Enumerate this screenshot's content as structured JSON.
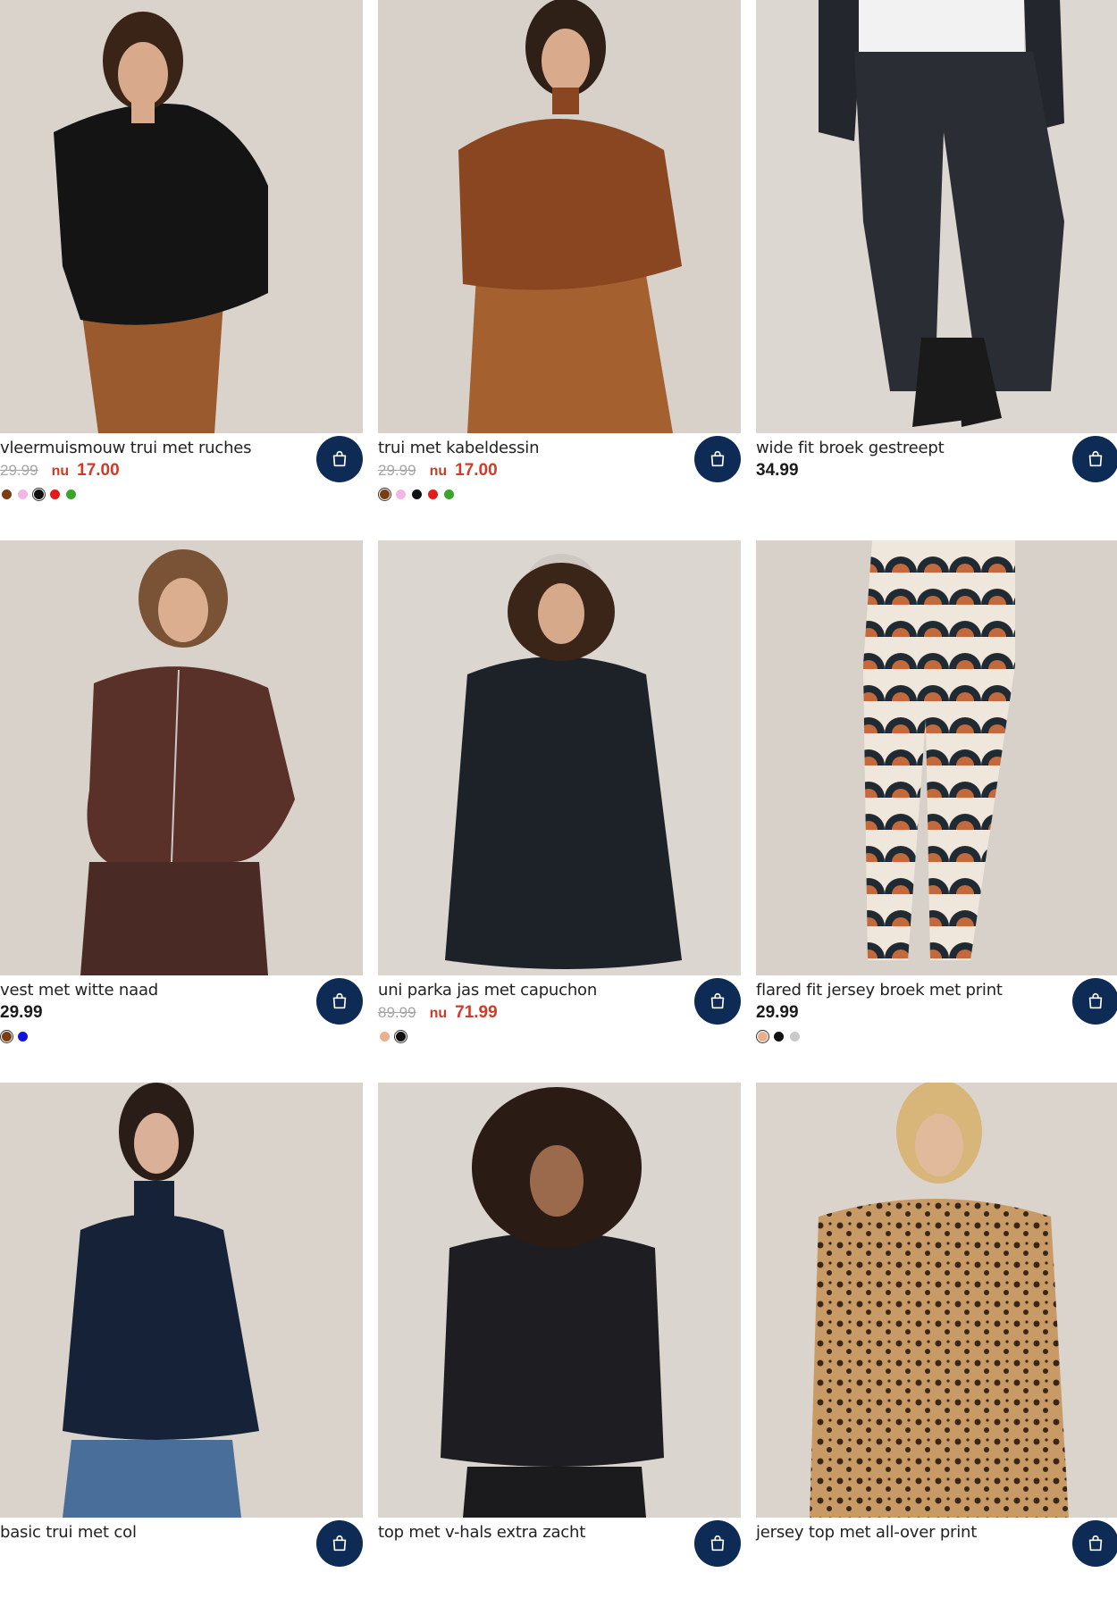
{
  "products": [
    {
      "title": "vleermuismouw trui met ruches",
      "old_price": "29.99",
      "now_label": "nu",
      "price": "17.00",
      "on_sale": true,
      "swatches": [
        "#7a3e12",
        "#f2b6e6",
        "#111111",
        "#e21b1b",
        "#3aa52a"
      ],
      "selected_swatch": 2,
      "image_alt": "model in black ruffle-sleeve sweater"
    },
    {
      "title": "trui met kabeldessin",
      "old_price": "29.99",
      "now_label": "nu",
      "price": "17.00",
      "on_sale": true,
      "swatches": [
        "#7a3e12",
        "#f2b6e6",
        "#111111",
        "#e21b1b",
        "#3aa52a"
      ],
      "selected_swatch": 0,
      "image_alt": "model in brown cable-knit sweater"
    },
    {
      "title": "wide fit broek gestreept",
      "price": "34.99",
      "on_sale": false,
      "swatches": [],
      "selected_swatch": -1,
      "image_alt": "model in pinstriped wide trousers"
    },
    {
      "title": "vest met witte naad",
      "price": "29.99",
      "on_sale": false,
      "swatches": [
        "#7a3e12",
        "#1414d8"
      ],
      "selected_swatch": 0,
      "image_alt": "model in brown zip vest"
    },
    {
      "title": "uni parka jas met capuchon",
      "old_price": "89.99",
      "now_label": "nu",
      "price": "71.99",
      "on_sale": true,
      "swatches": [
        "#e9b08e",
        "#111111"
      ],
      "selected_swatch": 1,
      "image_alt": "model in black parka with hood"
    },
    {
      "title": "flared fit jersey broek met print",
      "price": "29.99",
      "on_sale": false,
      "swatches": [
        "#e9b08e",
        "#111111",
        "#c9c9c9"
      ],
      "selected_swatch": 0,
      "image_alt": "model in printed flared trousers"
    },
    {
      "title": "basic trui met col",
      "price": "",
      "on_sale": false,
      "swatches": [],
      "selected_swatch": -1,
      "image_alt": "model in navy turtleneck"
    },
    {
      "title": "top met v-hals extra zacht",
      "price": "",
      "on_sale": false,
      "swatches": [],
      "selected_swatch": -1,
      "image_alt": "model in black v-neck top"
    },
    {
      "title": "jersey top met all-over print",
      "price": "",
      "on_sale": false,
      "swatches": [],
      "selected_swatch": -1,
      "image_alt": "model in leopard print top"
    }
  ],
  "icons": {
    "cart": "shopping-bag-icon"
  },
  "colors": {
    "accent_navy": "#0d2b55",
    "sale_red": "#d03b27",
    "strike_grey": "#a5a5a5"
  }
}
